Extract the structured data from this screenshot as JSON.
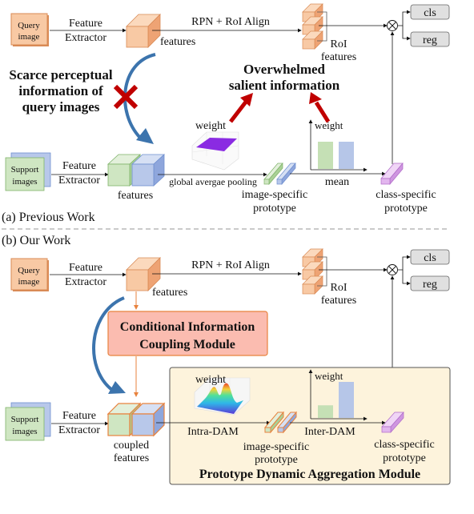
{
  "colors": {
    "query_fill": "#f8c9a4",
    "query_stroke": "#d98a55",
    "support_green": "#cfe6c2",
    "support_green_stroke": "#7fb36a",
    "support_blue": "#b8c8ea",
    "support_blue_stroke": "#6f8fcf",
    "class_proto": "#e2b6ee",
    "class_proto_stroke": "#b06ac8",
    "red_accent": "#c00000",
    "blue_arrow": "#3c74ad",
    "cicm_fill": "#fbbcb0",
    "cicm_stroke": "#e8823e",
    "pdam_fill": "#fdf3dc",
    "head_fill": "#e0e0e0",
    "flat_weight": "#8a2be2",
    "orange_arrow": "#e8823e"
  },
  "panel_a": {
    "query_image": [
      "Query",
      "image"
    ],
    "feature_extractor": [
      "Feature",
      "Extractor"
    ],
    "features": "features",
    "rpn": "RPN + RoI Align",
    "roi_features": [
      "RoI",
      "features"
    ],
    "cls": "cls",
    "reg": "reg",
    "problem1": [
      "Scarce perceptual",
      "information of",
      "query images"
    ],
    "problem2": [
      "Overwhelmed",
      "salient information"
    ],
    "weight": "weight",
    "support_images": [
      "Support",
      "images"
    ],
    "support_features": "features",
    "gap": "global avergae pooling",
    "image_proto": [
      "image-specific",
      "prototype"
    ],
    "mean": "mean",
    "bar_weight": "weight",
    "bar_values": [
      1.0,
      1.0
    ],
    "class_proto": [
      "class-specific",
      "prototype"
    ],
    "caption": "(a) Previous Work"
  },
  "panel_b": {
    "caption": "(b) Our Work",
    "query_image": [
      "Query",
      "image"
    ],
    "feature_extractor": [
      "Feature",
      "Extractor"
    ],
    "features": "features",
    "rpn": "RPN + RoI Align",
    "roi_features": [
      "RoI",
      "features"
    ],
    "cls": "cls",
    "reg": "reg",
    "cicm": [
      "Conditional Information",
      "Coupling Module"
    ],
    "support_images": [
      "Support",
      "images"
    ],
    "coupled_features": [
      "coupled",
      "features"
    ],
    "weight": "weight",
    "intra_dam": "Intra-DAM",
    "image_proto": [
      "image-specific",
      "prototype"
    ],
    "inter_dam": "Inter-DAM",
    "bar_weight": "weight",
    "bar_values": [
      0.35,
      1.0
    ],
    "class_proto": [
      "class-specific",
      "prototype"
    ],
    "pdam": "Prototype Dynamic Aggregation Module"
  }
}
